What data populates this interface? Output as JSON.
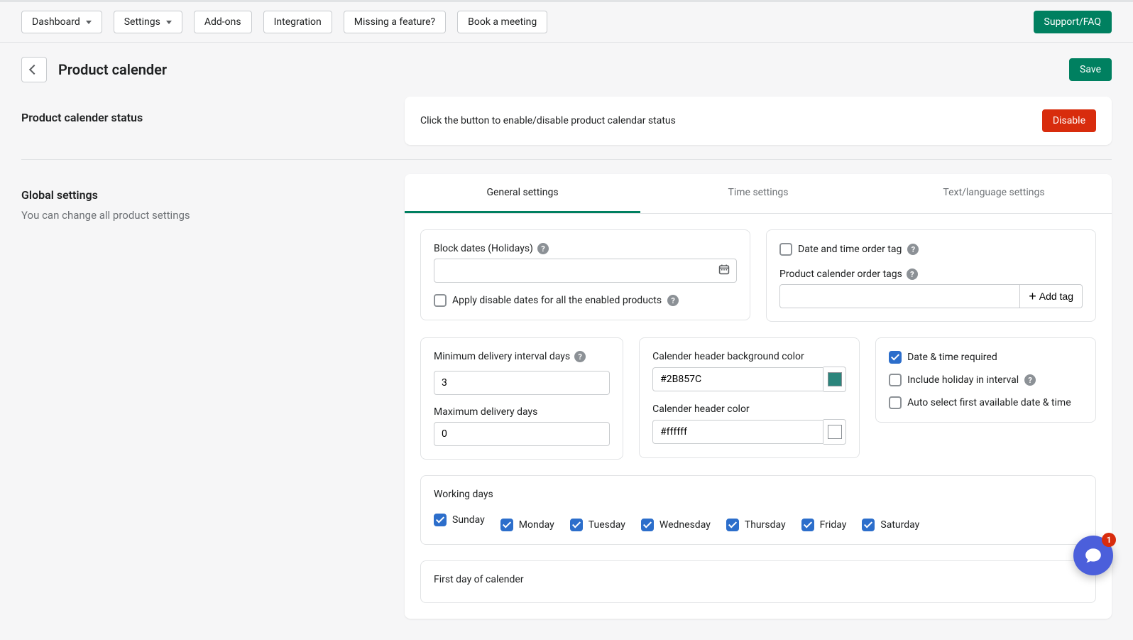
{
  "nav": {
    "dashboard": "Dashboard",
    "settings": "Settings",
    "addons": "Add-ons",
    "integration": "Integration",
    "missing": "Missing a feature?",
    "book": "Book a meeting",
    "support": "Support/FAQ"
  },
  "header": {
    "title": "Product calender",
    "save": "Save"
  },
  "status": {
    "left_title": "Product calender status",
    "desc": "Click the button to enable/disable product calendar status",
    "button": "Disable"
  },
  "global": {
    "title": "Global settings",
    "desc": "You can change all product settings"
  },
  "tabs": {
    "general": "General settings",
    "time": "Time settings",
    "text": "Text/language settings"
  },
  "block_dates": {
    "label": "Block dates (Holidays)",
    "apply_all": "Apply disable dates for all the enabled products"
  },
  "order_tags": {
    "date_time_tag": "Date and time order tag",
    "label": "Product calender order tags",
    "add_tag": "Add tag"
  },
  "delivery": {
    "min_label": "Minimum delivery interval days",
    "min_value": "3",
    "max_label": "Maximum delivery days",
    "max_value": "0"
  },
  "colors": {
    "bg_label": "Calender header background color",
    "bg_value": "#2B857C",
    "fg_label": "Calender header color",
    "fg_value": "#ffffff"
  },
  "options": {
    "required": "Date & time required",
    "holiday_interval": "Include holiday in interval",
    "auto_select": "Auto select first available date & time"
  },
  "working_days": {
    "label": "Working days",
    "days": [
      "Sunday",
      "Monday",
      "Tuesday",
      "Wednesday",
      "Thursday",
      "Friday",
      "Saturday"
    ]
  },
  "first_day": {
    "label": "First day of calender"
  },
  "chat": {
    "badge": "1"
  }
}
